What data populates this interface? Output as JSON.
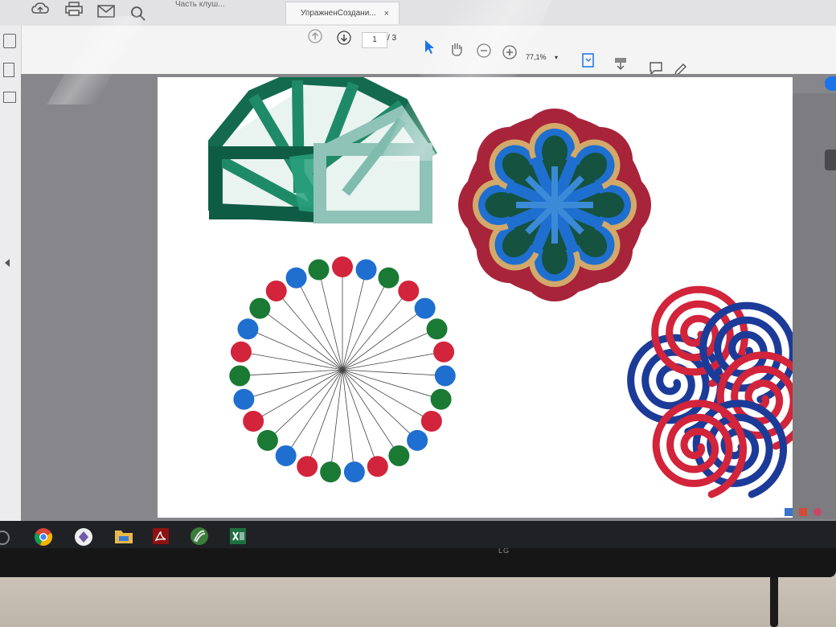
{
  "tabs": {
    "inactive_label": "Часть клуш...",
    "active_label": "УпражненСоздани...",
    "close": "×"
  },
  "toolbar": {
    "page_current": "1",
    "page_total": "/ 3",
    "zoom": "77,1%"
  },
  "icons": [
    "cloud-upload-icon",
    "print-icon",
    "mail-icon",
    "search-icon",
    "page-up-icon",
    "page-down-icon",
    "cursor-icon",
    "hand-icon",
    "zoom-out-icon",
    "zoom-in-icon",
    "fit-page-icon",
    "comment-icon",
    "pen-icon"
  ],
  "monitor_brand": "LG",
  "taskbar_apps": [
    "chrome",
    "media-player",
    "file-explorer",
    "acrobat-reader",
    "app",
    "excel"
  ],
  "colors": {
    "green_dark": "#0f5c44",
    "green_mid": "#1f9272",
    "green_light": "#7fbcae",
    "red": "#d2243b",
    "blue": "#1f6fd0",
    "green_dot": "#1a7a34",
    "navy": "#1c3b99",
    "maroon": "#a8243a",
    "tan": "#d2a96a"
  }
}
